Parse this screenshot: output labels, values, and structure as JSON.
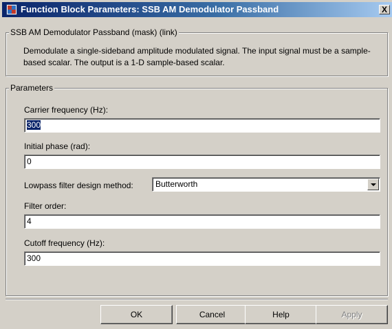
{
  "window": {
    "title": "Function Block Parameters: SSB AM Demodulator Passband",
    "close_glyph": "X"
  },
  "mask_group": {
    "legend": "SSB AM Demodulator Passband (mask) (link)",
    "description": "Demodulate a single-sideband amplitude modulated signal. The input signal must be a sample-based scalar. The output is a 1-D sample-based scalar."
  },
  "parameters": {
    "legend": "Parameters",
    "carrier_frequency": {
      "label": "Carrier frequency (Hz):",
      "value": "300"
    },
    "initial_phase": {
      "label": "Initial phase (rad):",
      "value": "0"
    },
    "lowpass_method": {
      "label": "Lowpass filter design method:",
      "value": "Butterworth"
    },
    "filter_order": {
      "label": "Filter order:",
      "value": "4"
    },
    "cutoff_frequency": {
      "label": "Cutoff frequency (Hz):",
      "value": "300"
    }
  },
  "buttons": {
    "ok": "OK",
    "cancel": "Cancel",
    "help": "Help",
    "apply": "Apply"
  },
  "icons": {
    "window_icon": "simulink-block-icon",
    "close": "close-icon",
    "dropdown": "chevron-down-icon"
  },
  "colors": {
    "titlebar_start": "#0a246a",
    "titlebar_end": "#a6caf0",
    "dialog_face": "#d4d0c8",
    "selection": "#0a246a"
  }
}
